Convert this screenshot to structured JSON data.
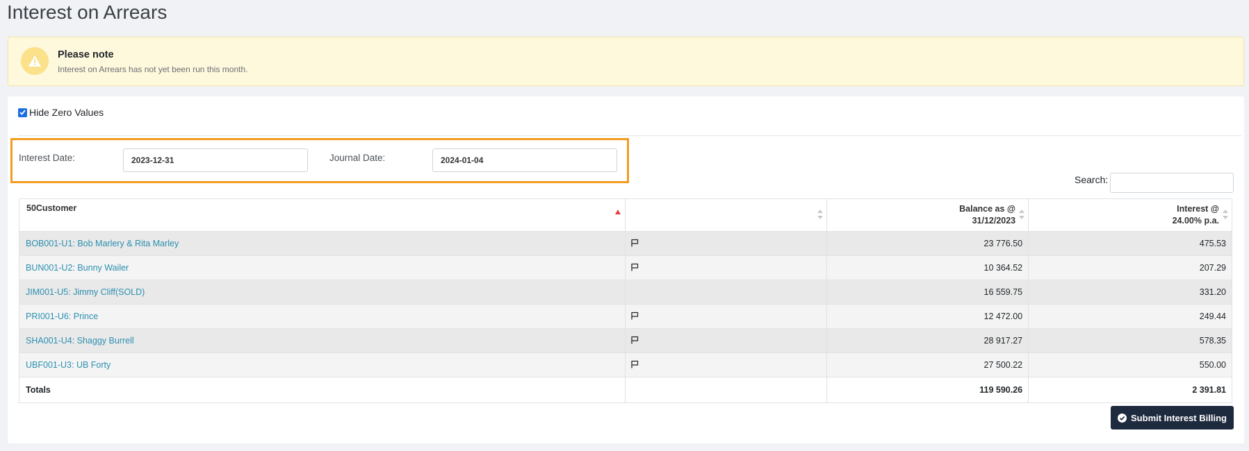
{
  "page": {
    "title": "Interest on Arrears"
  },
  "alert": {
    "title": "Please note",
    "text": "Interest on Arrears has not yet been run this month."
  },
  "filters": {
    "hide_zero_label": "Hide Zero Values",
    "hide_zero_checked": true,
    "interest_date_label": "Interest Date:",
    "interest_date_value": "2023-12-31",
    "journal_date_label": "Journal Date:",
    "journal_date_value": "2024-01-04",
    "search_label": "Search:",
    "search_value": ""
  },
  "table": {
    "headers": {
      "customer": "50Customer",
      "flag": "",
      "balance_line1": "Balance as @",
      "balance_line2": "31/12/2023",
      "interest_line1": "Interest @",
      "interest_line2": "24.00% p.a."
    },
    "rows": [
      {
        "customer": "BOB001-U1: Bob Marlery & Rita Marley",
        "flagged": true,
        "balance": "23 776.50",
        "interest": "475.53"
      },
      {
        "customer": "BUN001-U2: Bunny Wailer",
        "flagged": true,
        "balance": "10 364.52",
        "interest": "207.29"
      },
      {
        "customer": "JIM001-U5: Jimmy Cliff(SOLD)",
        "flagged": false,
        "balance": "16 559.75",
        "interest": "331.20"
      },
      {
        "customer": "PRI001-U6: Prince",
        "flagged": true,
        "balance": "12 472.00",
        "interest": "249.44"
      },
      {
        "customer": "SHA001-U4: Shaggy Burrell",
        "flagged": true,
        "balance": "28 917.27",
        "interest": "578.35"
      },
      {
        "customer": "UBF001-U3: UB Forty",
        "flagged": true,
        "balance": "27 500.22",
        "interest": "550.00"
      }
    ],
    "totals": {
      "label": "Totals",
      "balance": "119 590.26",
      "interest": "2 391.81"
    }
  },
  "actions": {
    "submit_label": "Submit Interest Billing"
  },
  "colors": {
    "accent_link": "#2b8fb0",
    "highlight_border": "#f39c1f",
    "button_bg": "#1e2a3e",
    "alert_bg": "#fef8dd"
  },
  "icons": {
    "alert": "warning-triangle-icon",
    "flag": "flag-icon",
    "submit": "check-circle-icon"
  }
}
